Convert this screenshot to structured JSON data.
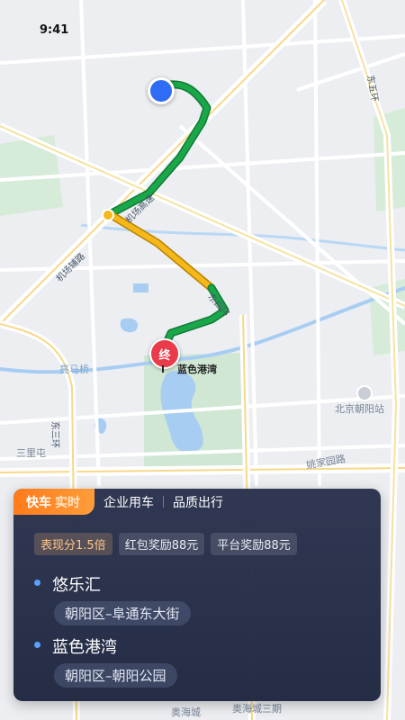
{
  "status_bar": {
    "time": "9:41"
  },
  "map": {
    "destination_pin": "终",
    "destination_label": "蓝色港湾",
    "places": {
      "liangmaqiao": "亮马桥",
      "beijing_chaoyang_station": "北京朝阳站",
      "sanlitun": "三里屯",
      "yaojiayuan_road": "姚家园路",
      "aohaicheng": "奥海城",
      "aohaicheng_phase3": "奥海城三期"
    },
    "roads": {
      "airport_expressway": "机场高速",
      "dongsanhuan": "东三环",
      "dongsihuan": "东四环",
      "dongwuhuan": "东五环",
      "jichang_2": "机场辅路"
    }
  },
  "card": {
    "tabs": [
      {
        "label": "快车",
        "suffix": "实时"
      },
      {
        "label": "企业用车"
      },
      {
        "label": "品质出行"
      }
    ],
    "badges": [
      "表现分1.5倍",
      "红包奖励88元",
      "平台奖励88元"
    ],
    "origin": {
      "name": "悠乐汇",
      "address": "朝阳区–阜通东大街"
    },
    "destination": {
      "name": "蓝色港湾",
      "address": "朝阳区–朝阳公园"
    }
  },
  "colors": {
    "route_green": "#1aa74a",
    "route_yellow": "#f5b81a",
    "card_bg": "#28304c",
    "active_tab": "#ff7a1a",
    "destination_pin": "#e93b49",
    "start_marker": "#2f6cf5"
  }
}
